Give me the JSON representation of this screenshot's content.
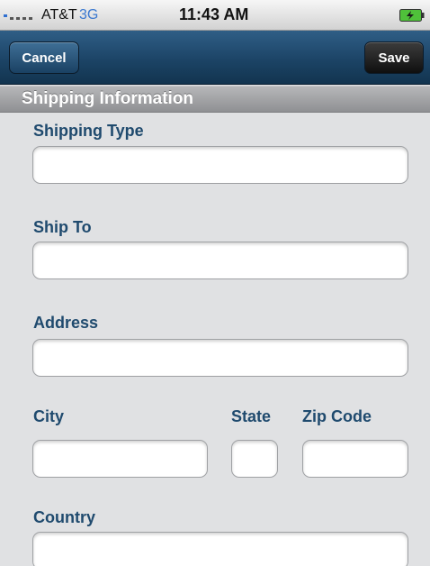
{
  "status_bar": {
    "carrier": "AT&T",
    "network": "3G",
    "time": "11:43 AM",
    "signal_icon": "signal-strength-icon",
    "battery_icon": "battery-charging-icon"
  },
  "nav": {
    "cancel_label": "Cancel",
    "save_label": "Save"
  },
  "section": {
    "title": "Shipping Information"
  },
  "form": {
    "shipping_type": {
      "label": "Shipping Type",
      "value": ""
    },
    "ship_to": {
      "label": "Ship To",
      "value": ""
    },
    "address": {
      "label": "Address",
      "value": ""
    },
    "city": {
      "label": "City",
      "value": ""
    },
    "state": {
      "label": "State",
      "value": ""
    },
    "zip_code": {
      "label": "Zip Code",
      "value": ""
    },
    "country": {
      "label": "Country",
      "value": ""
    }
  },
  "colors": {
    "nav_bar": "#1c4466",
    "label_text": "#1f4a6e",
    "background": "#e0e1e3",
    "network_text": "#3a78d0"
  }
}
